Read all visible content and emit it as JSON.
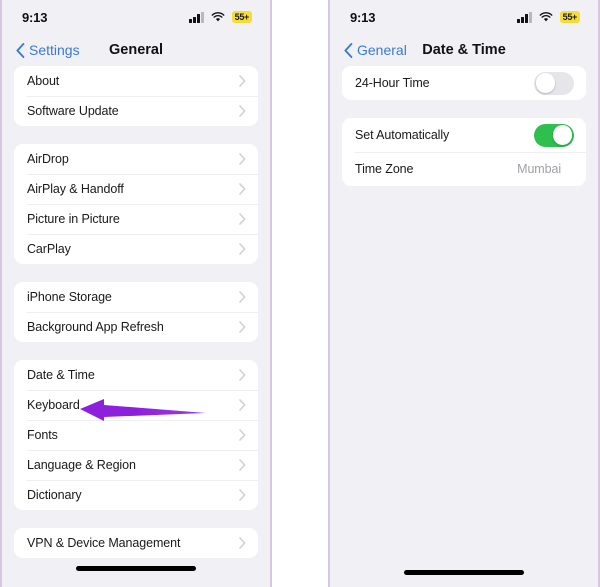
{
  "status_bar": {
    "time": "9:13",
    "cellular_icon": "cellular-bars-icon",
    "wifi_icon": "wifi-icon",
    "battery_text": "55+"
  },
  "left_screen": {
    "back_label": "Settings",
    "title": "General",
    "groups": [
      {
        "rows": [
          {
            "label": "About",
            "accessory": "chevron"
          },
          {
            "label": "Software Update",
            "accessory": "chevron"
          }
        ]
      },
      {
        "rows": [
          {
            "label": "AirDrop",
            "accessory": "chevron"
          },
          {
            "label": "AirPlay & Handoff",
            "accessory": "chevron"
          },
          {
            "label": "Picture in Picture",
            "accessory": "chevron"
          },
          {
            "label": "CarPlay",
            "accessory": "chevron"
          }
        ]
      },
      {
        "rows": [
          {
            "label": "iPhone Storage",
            "accessory": "chevron"
          },
          {
            "label": "Background App Refresh",
            "accessory": "chevron"
          }
        ]
      },
      {
        "rows": [
          {
            "label": "Date & Time",
            "accessory": "chevron"
          },
          {
            "label": "Keyboard",
            "accessory": "chevron"
          },
          {
            "label": "Fonts",
            "accessory": "chevron"
          },
          {
            "label": "Language & Region",
            "accessory": "chevron"
          },
          {
            "label": "Dictionary",
            "accessory": "chevron"
          }
        ]
      },
      {
        "rows": [
          {
            "label": "VPN & Device Management",
            "accessory": "chevron"
          }
        ]
      }
    ]
  },
  "right_screen": {
    "back_label": "General",
    "title": "Date & Time",
    "groups": [
      {
        "rows": [
          {
            "label": "24-Hour Time",
            "accessory": "toggle",
            "toggle_on": false
          }
        ]
      },
      {
        "rows": [
          {
            "label": "Set Automatically",
            "accessory": "toggle",
            "toggle_on": true
          },
          {
            "label": "Time Zone",
            "accessory": "value",
            "value": "Mumbai"
          }
        ]
      }
    ]
  },
  "annotations": {
    "arrow_color": "#8e20dd",
    "left_arrow_target": "Date & Time",
    "right_arrow_target": "Set Automatically toggle"
  },
  "colors": {
    "accent_blue": "#3a7bd0",
    "toggle_on_green": "#2fbf4f",
    "toggle_off_gray": "#e6e6ea",
    "battery_yellow": "#f5dd35",
    "panel_background": "#f1f0f5",
    "card_background": "#ffffff",
    "panel_border": "#d9c7e2",
    "annotation_purple": "#8e20dd"
  }
}
